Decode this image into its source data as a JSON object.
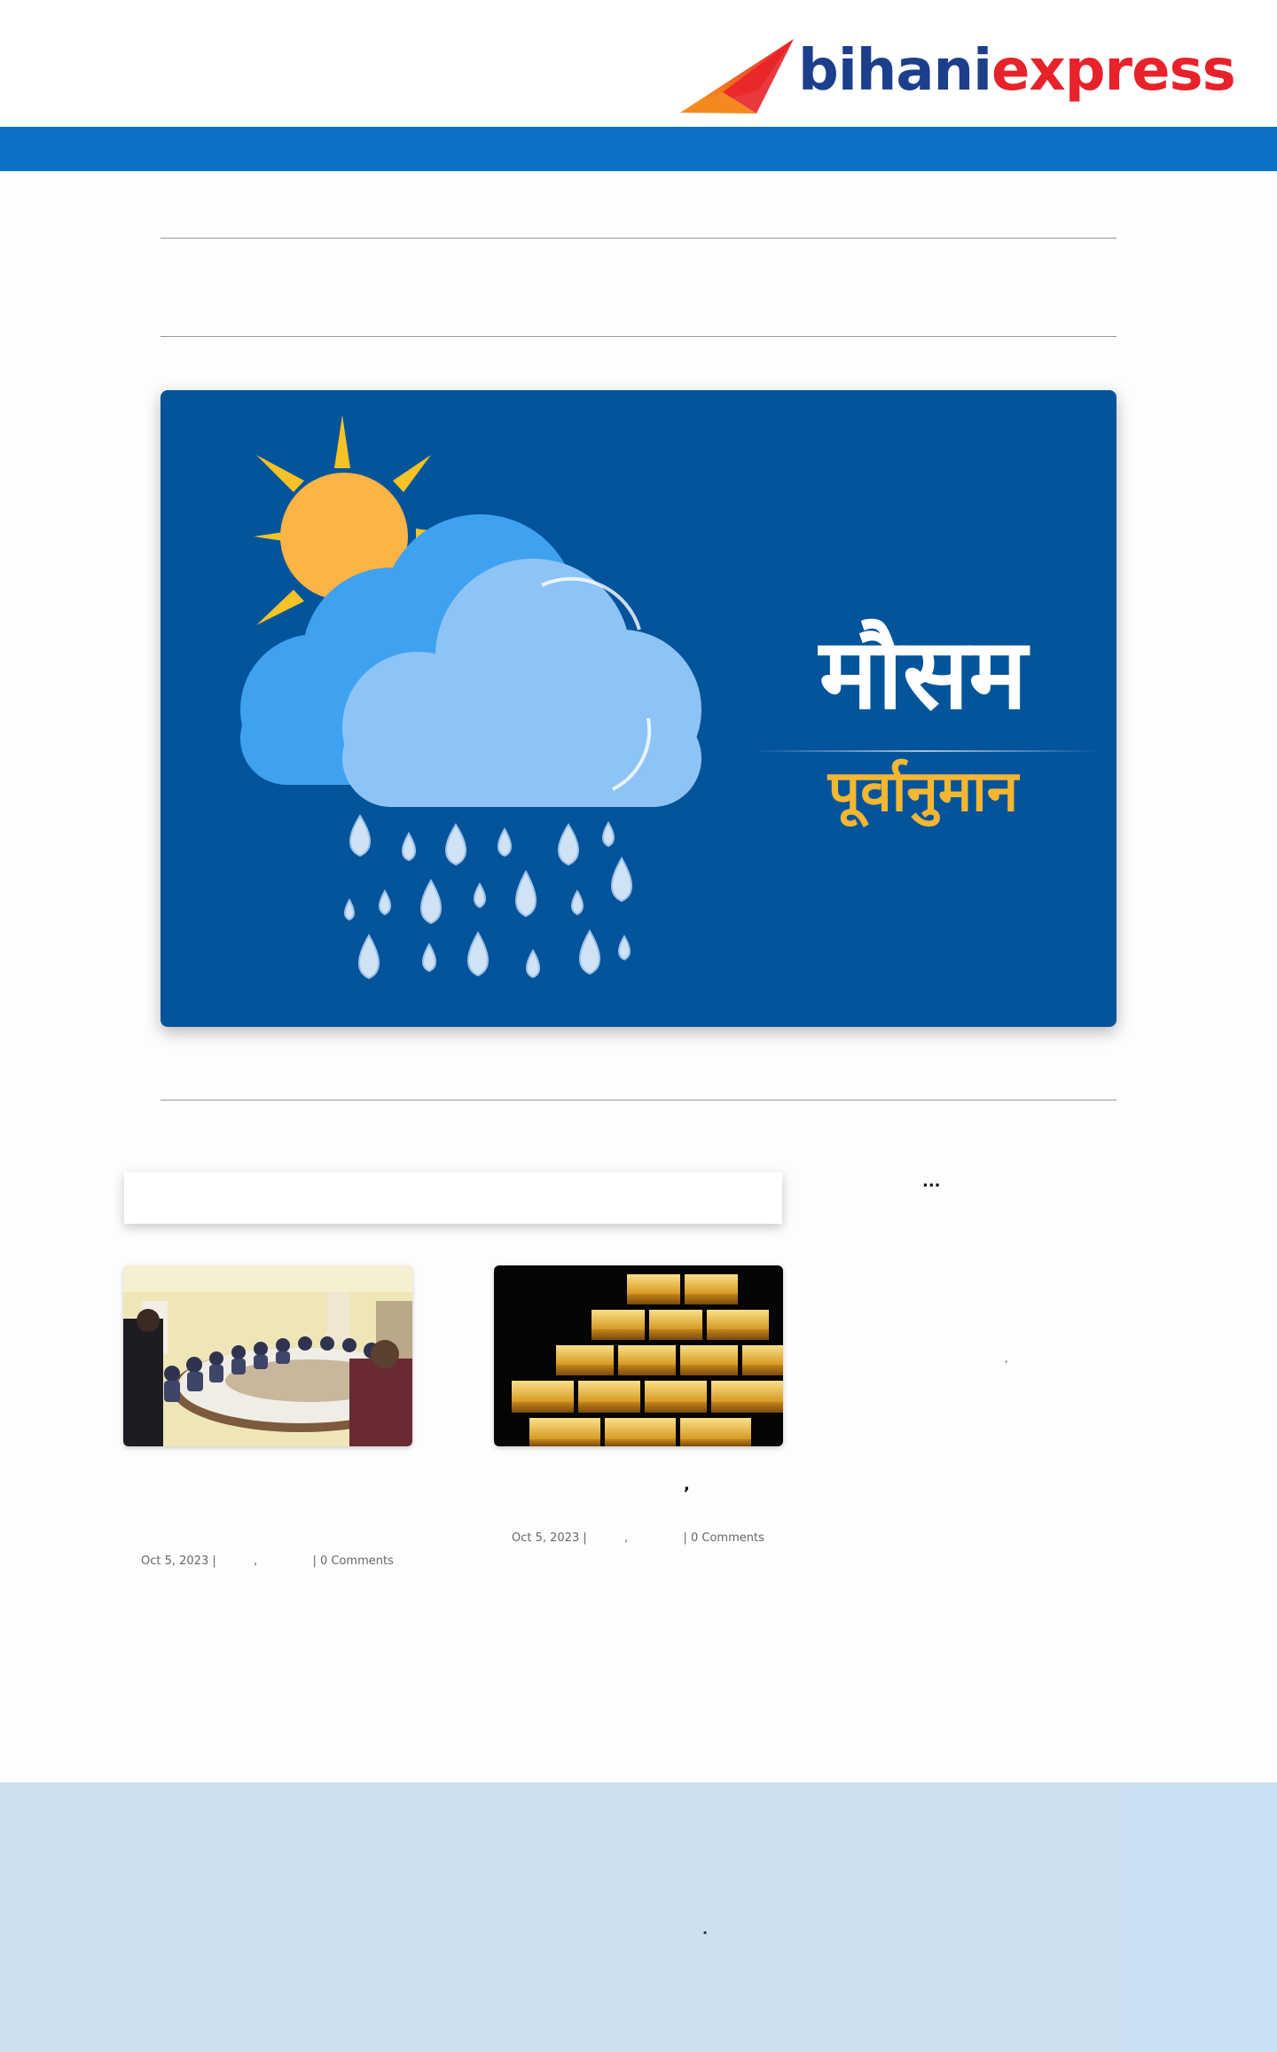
{
  "brand": {
    "logo_part1": "bihani",
    "logo_part2": "express",
    "color_primary": "#1b3f8b",
    "color_accent": "#e8222a",
    "nav_color": "#0d71c5"
  },
  "hero": {
    "title": "मौसम",
    "subtitle": "पूर्वानुमान",
    "background": "#04549c",
    "icon": "weather-sun-cloud-rain-icon"
  },
  "search": {
    "placeholder": ""
  },
  "sidebar": {
    "ellipsis": "...",
    "mark": ","
  },
  "posts": [
    {
      "image": "meeting-room-photo",
      "date": "Oct 5, 2023 |",
      "comma": ",",
      "comments": "| 0 Comments"
    },
    {
      "image": "gold-bars-photo",
      "title_mark": ",",
      "date": "Oct 5, 2023 |",
      "comma": ",",
      "comments": "| 0 Comments"
    }
  ],
  "footer": {
    "mark": "."
  }
}
